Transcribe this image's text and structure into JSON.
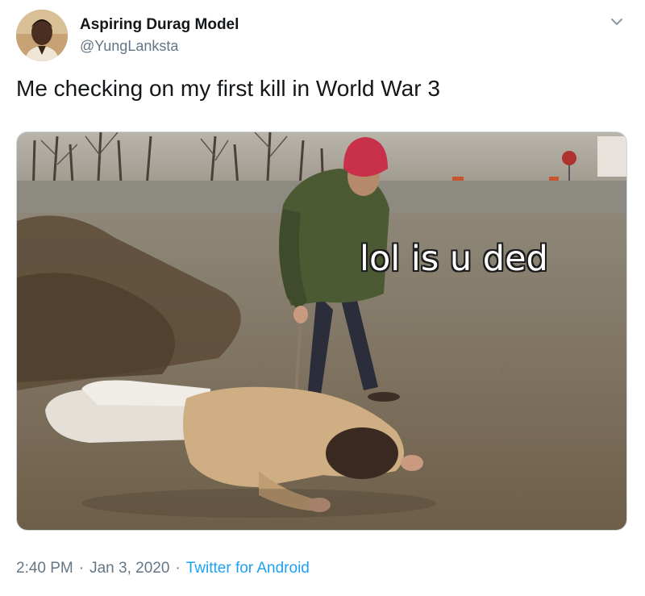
{
  "tweet": {
    "author": {
      "display_name": "Aspiring Durag Model",
      "handle": "@YungLanksta",
      "avatar_icon": "profile-photo"
    },
    "text": "Me checking on my first kill in World War 3",
    "media": {
      "caption": "lol is u ded"
    },
    "meta": {
      "time": "2:40 PM",
      "separator": "·",
      "date": "Jan 3, 2020",
      "source": "Twitter for Android"
    },
    "menu_icon": "chevron-down-icon"
  },
  "colors": {
    "text_primary": "#14171a",
    "text_secondary": "#657786",
    "link": "#1da1f2",
    "border": "#ccd6dd"
  }
}
